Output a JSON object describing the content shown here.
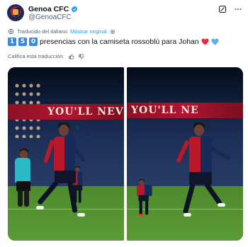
{
  "account": {
    "display_name": "Genoa CFC",
    "handle": "@GenoaCFC",
    "verified": true,
    "avatar_icon": "genoa-crest-logo"
  },
  "header_actions": {
    "grok_icon": "grok-icon",
    "more_icon": "more-horizontal-icon"
  },
  "translation": {
    "label": "Traducido del italiano",
    "show_original": "Mostrar original",
    "settings_icon": "gear-icon",
    "rate_label": "Califica esta traducción:",
    "thumbs_up_icon": "thumbs-up-icon",
    "thumbs_down_icon": "thumbs-down-icon"
  },
  "tweet": {
    "digits": [
      "1",
      "5",
      "0"
    ],
    "text": "presencias con la camiseta rossoblù para Johan",
    "emoji": [
      "red-heart",
      "blue-heart"
    ]
  },
  "media": {
    "left_banner": "YOU'LL NEVE",
    "right_banner": "YOU'LL NE"
  },
  "colors": {
    "accent_link": "#1d9bf0",
    "verified_blue": "#1d9bf0",
    "secondary_text": "#536471",
    "keycap_blue": "#3b88e0",
    "genoa_red": "#b8182a",
    "genoa_blue": "#182a5a"
  }
}
